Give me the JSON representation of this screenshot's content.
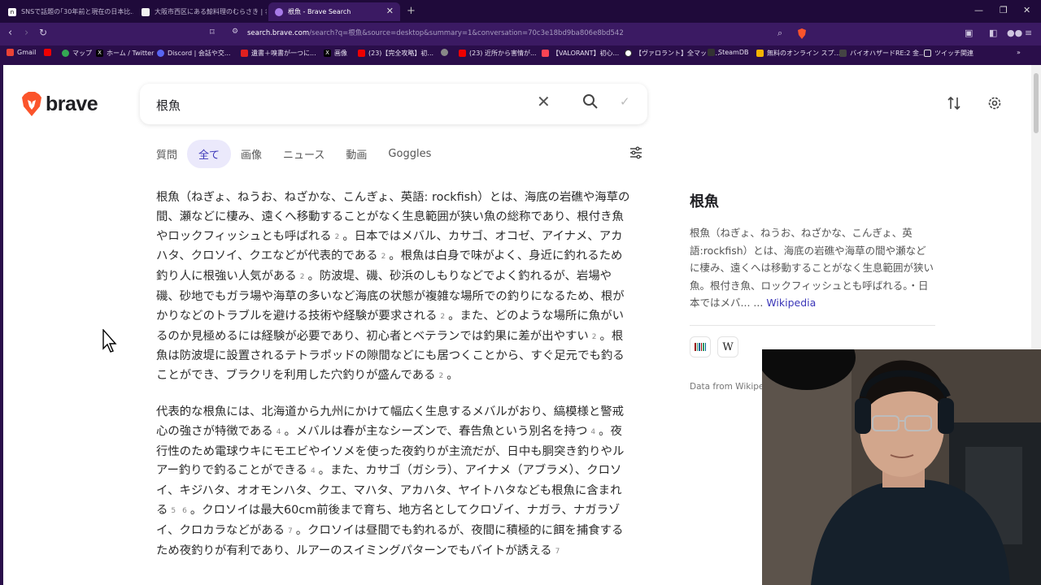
{
  "browser": {
    "tabs": [
      {
        "label": "SNSで話題の｢30年前と現在の日本比..."
      },
      {
        "label": "大阪市西区にある鯨料理のむらさき | 名..."
      },
      {
        "label": "根魚 - Brave Search"
      }
    ],
    "url_host": "search.brave.com",
    "url_path": "/search?q=根魚&source=desktop&summary=1&conversation=70c3e18bd9ba806e8bd542",
    "bookmarks": [
      "Gmail",
      "マップ",
      "ホーム / Twitter",
      "Discord | 会話や交...",
      "遺書＋嗅書が一つに...",
      "画像",
      "(23)【完全攻略】初...",
      "(23) 近所から害情が...",
      "【VALORANT】初心...",
      "【ヴァロラント】全マップ...",
      "SteamDB",
      "無料のオンライン スプ...",
      "バイオハザードRE:2 金...",
      "ツイッチ関連"
    ]
  },
  "search": {
    "logo": "brave",
    "query": "根魚",
    "tabs": [
      "質問",
      "全て",
      "画像",
      "ニュース",
      "動画",
      "Goggles"
    ]
  },
  "summary": {
    "p1": [
      "根魚（ねぎょ、ねうお、ねざかな、こんぎょ、英語: rockfish）とは、海底の岩礁や海草の間、瀬などに棲み、遠くへ移動することがなく生息範囲が狭い魚の総称であり、根付き魚やロックフィッシュとも呼ばれる",
      "2",
      "。日本ではメバル、カサゴ、オコゼ、アイナメ、アカハタ、クロソイ、クエなどが代表的である",
      "2",
      "。根魚は白身で味がよく、身近に釣れるため釣り人に根強い人気がある",
      "2",
      "。防波堤、磯、砂浜のしもりなどでよく釣れるが、岩場や磯、砂地でもガラ場や海草の多いなど海底の状態が複雑な場所での釣りになるため、根がかりなどのトラブルを避ける技術や経験が要求される",
      "2",
      "。また、どのような場所に魚がいるのか見極めるには経験が必要であり、初心者とベテランでは釣果に差が出やすい",
      "2",
      "。根魚は防波堤に設置されるテトラポッドの隙間などにも居つくことから、すぐ足元でも釣ることができ、ブラクリを利用した穴釣りが盛んである",
      "2",
      "。"
    ],
    "p2": [
      "代表的な根魚には、北海道から九州にかけて幅広く生息するメバルがおり、縞模様と警戒心の強さが特徴である",
      "4",
      "。メバルは春が主なシーズンで、春告魚という別名を持つ",
      "4",
      "。夜行性のため電球ウキにモエビやイソメを使った夜釣りが主流だが、日中も胴突き釣りやルアー釣りで釣ることができる",
      "4",
      "。また、カサゴ（ガシラ）、アイナメ（アブラメ）、クロソイ、キジハタ、オオモンハタ、クエ、マハタ、アカハタ、ヤイトハタなども根魚に含まれる",
      "5",
      "6",
      "。クロソイは最大60cm前後まで育ち、地方名としてクロゾイ、ナガラ、ナガラゾイ、クロカラなどがある",
      "7",
      "。クロソイは昼間でも釣れるが、夜間に積極的に餌を捕食するため夜釣りが有利であり、ルアーのスイミングパターンでもバイトが誘える",
      "7"
    ]
  },
  "knowledge_panel": {
    "title": "根魚",
    "description": "根魚（ねぎょ、ねうお、ねざかな、こんぎょ、英語:rockfish）とは、海底の岩礁や海草の間や瀬などに棲み、遠くへは移動することがなく生息範囲が狭い魚。根付き魚、ロックフィッシュとも呼ばれる。・日本ではメバ... ...",
    "source_link": "Wikipedia",
    "data_from": "Data from Wikiped"
  },
  "colors": {
    "accent": "#3b36b8",
    "brave_orange": "#fb542b",
    "browser_frame": "#2a0e4a"
  }
}
